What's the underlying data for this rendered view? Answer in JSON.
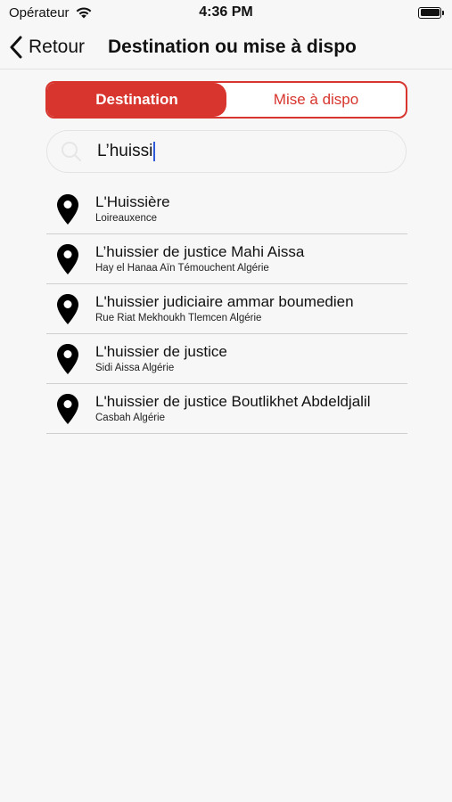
{
  "status_bar": {
    "carrier": "Opérateur",
    "time": "4:36 PM"
  },
  "nav": {
    "back_label": "Retour",
    "title": "Destination ou mise à dispo"
  },
  "segmented": {
    "options": [
      "Destination",
      "Mise à dispo"
    ],
    "selected": "Destination"
  },
  "search": {
    "value": "L’huissi"
  },
  "results": [
    {
      "title": "L'Huissière",
      "subtitle": "Loireauxence"
    },
    {
      "title": "L’huissier de justice Mahi Aissa",
      "subtitle": "Hay el Hanaa Aïn Témouchent Algérie"
    },
    {
      "title": "L'huissier judiciaire ammar boumedien",
      "subtitle": "Rue Riat Mekhoukh Tlemcen Algérie"
    },
    {
      "title": "L'huissier de justice",
      "subtitle": "Sidi Aissa Algérie"
    },
    {
      "title": "L'huissier de justice Boutlikhet Abdeldjalil",
      "subtitle": "Casbah Algérie"
    }
  ],
  "colors": {
    "accent": "#d7352d",
    "caret": "#2f5bd9"
  },
  "icons": {
    "back": "chevron-left-icon",
    "search": "search-icon",
    "result": "map-pin-icon"
  }
}
